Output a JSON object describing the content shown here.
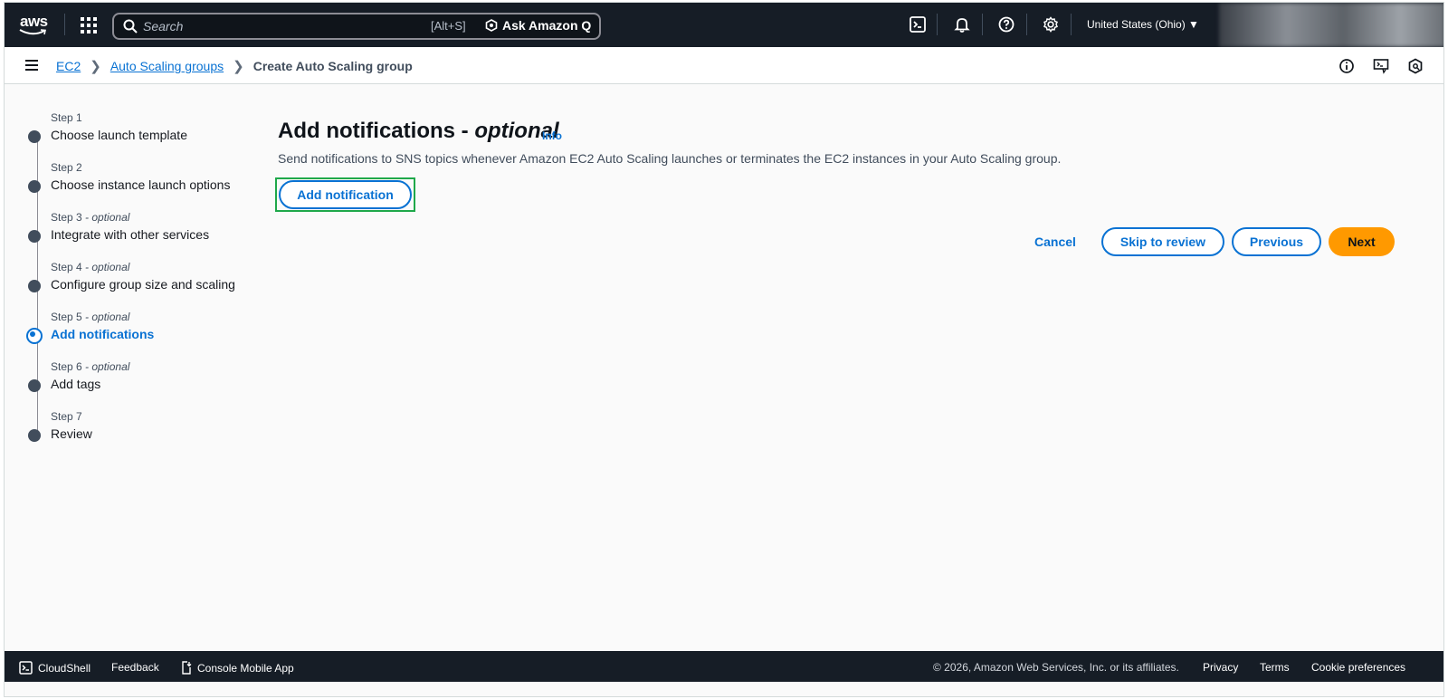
{
  "topnav": {
    "logo_text": "aws",
    "search_placeholder": "Search",
    "search_shortcut": "[Alt+S]",
    "ask_q_label": "Ask Amazon Q",
    "region_label": "United States (Ohio) ▼"
  },
  "breadcrumb": {
    "items": [
      "EC2",
      "Auto Scaling groups"
    ],
    "current": "Create Auto Scaling group"
  },
  "steps": [
    {
      "num": "Step 1",
      "optional": "",
      "label": "Choose launch template"
    },
    {
      "num": "Step 2",
      "optional": "",
      "label": "Choose instance launch options"
    },
    {
      "num": "Step 3",
      "optional": " - optional",
      "label": "Integrate with other services"
    },
    {
      "num": "Step 4",
      "optional": " - optional",
      "label": "Configure group size and scaling"
    },
    {
      "num": "Step 5",
      "optional": " - optional",
      "label": "Add notifications"
    },
    {
      "num": "Step 6",
      "optional": " - optional",
      "label": "Add tags"
    },
    {
      "num": "Step 7",
      "optional": "",
      "label": "Review"
    }
  ],
  "main": {
    "title": "Add notifications - ",
    "title_optional": "optional",
    "info_link": "Info",
    "description": "Send notifications to SNS topics whenever Amazon EC2 Auto Scaling launches or terminates the EC2 instances in your Auto Scaling group.",
    "add_notification_label": "Add notification"
  },
  "actions": {
    "cancel": "Cancel",
    "skip": "Skip to review",
    "previous": "Previous",
    "next": "Next"
  },
  "footer": {
    "cloudshell": "CloudShell",
    "feedback": "Feedback",
    "mobile_app": "Console Mobile App",
    "copyright": "© 2026, Amazon Web Services, Inc. or its affiliates.",
    "privacy": "Privacy",
    "terms": "Terms",
    "cookies": "Cookie preferences"
  },
  "colors": {
    "nav_bg": "#161d26",
    "link": "#0972d3",
    "primary": "#ff9900",
    "highlight": "#1fa84a"
  }
}
